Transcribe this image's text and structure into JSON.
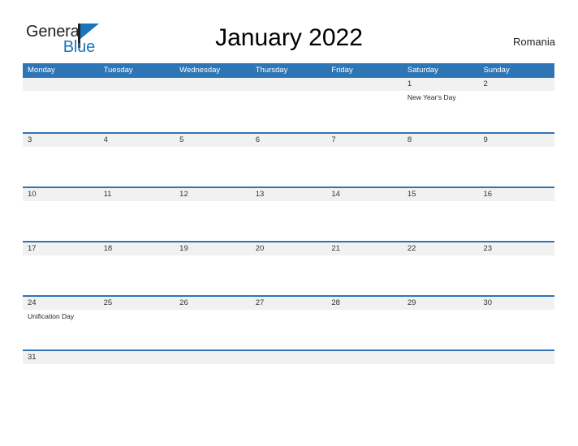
{
  "logo": {
    "word_one": "General",
    "word_two": "Blue",
    "flag_icon": "blue-flag-icon",
    "dark_color": "#231f20",
    "blue_color": "#1b75bb"
  },
  "header": {
    "title": "January 2022",
    "region": "Romania"
  },
  "theme": {
    "header_blue": "#2e75b6",
    "band_gray": "#f1f1f1",
    "page_background": "#ffffff"
  },
  "calendar": {
    "weekdays": [
      "Monday",
      "Tuesday",
      "Wednesday",
      "Thursday",
      "Friday",
      "Saturday",
      "Sunday"
    ],
    "weeks": [
      [
        {
          "day": "",
          "event": ""
        },
        {
          "day": "",
          "event": ""
        },
        {
          "day": "",
          "event": ""
        },
        {
          "day": "",
          "event": ""
        },
        {
          "day": "",
          "event": ""
        },
        {
          "day": "1",
          "event": "New Year's Day"
        },
        {
          "day": "2",
          "event": ""
        }
      ],
      [
        {
          "day": "3",
          "event": ""
        },
        {
          "day": "4",
          "event": ""
        },
        {
          "day": "5",
          "event": ""
        },
        {
          "day": "6",
          "event": ""
        },
        {
          "day": "7",
          "event": ""
        },
        {
          "day": "8",
          "event": ""
        },
        {
          "day": "9",
          "event": ""
        }
      ],
      [
        {
          "day": "10",
          "event": ""
        },
        {
          "day": "11",
          "event": ""
        },
        {
          "day": "12",
          "event": ""
        },
        {
          "day": "13",
          "event": ""
        },
        {
          "day": "14",
          "event": ""
        },
        {
          "day": "15",
          "event": ""
        },
        {
          "day": "16",
          "event": ""
        }
      ],
      [
        {
          "day": "17",
          "event": ""
        },
        {
          "day": "18",
          "event": ""
        },
        {
          "day": "19",
          "event": ""
        },
        {
          "day": "20",
          "event": ""
        },
        {
          "day": "21",
          "event": ""
        },
        {
          "day": "22",
          "event": ""
        },
        {
          "day": "23",
          "event": ""
        }
      ],
      [
        {
          "day": "24",
          "event": "Unification Day"
        },
        {
          "day": "25",
          "event": ""
        },
        {
          "day": "26",
          "event": ""
        },
        {
          "day": "27",
          "event": ""
        },
        {
          "day": "28",
          "event": ""
        },
        {
          "day": "29",
          "event": ""
        },
        {
          "day": "30",
          "event": ""
        }
      ],
      [
        {
          "day": "31",
          "event": ""
        },
        {
          "day": "",
          "event": ""
        },
        {
          "day": "",
          "event": ""
        },
        {
          "day": "",
          "event": ""
        },
        {
          "day": "",
          "event": ""
        },
        {
          "day": "",
          "event": ""
        },
        {
          "day": "",
          "event": ""
        }
      ]
    ]
  }
}
